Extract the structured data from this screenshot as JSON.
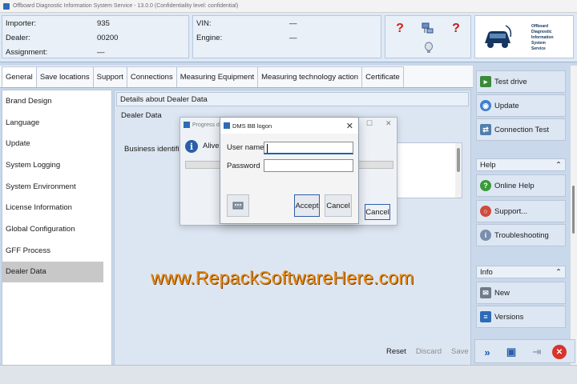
{
  "window": {
    "title": "Offboard Diagnostic Information System Service - 13.0.0 (Confidentiality level: confidential)"
  },
  "header": {
    "left": [
      {
        "label": "Importer:",
        "value": "935"
      },
      {
        "label": "Dealer:",
        "value": "00200"
      },
      {
        "label": "Assignment:",
        "value": "—"
      }
    ],
    "mid": [
      {
        "label": "VIN:",
        "value": "—"
      },
      {
        "label": "Engine:",
        "value": "—"
      }
    ],
    "logo_lines": [
      "Offboard",
      "Diagnostic",
      "Information",
      "System",
      "Service"
    ]
  },
  "tabs": [
    "General",
    "Save locations",
    "Support",
    "Connections",
    "Measuring Equipment",
    "Measuring technology action",
    "Certificate"
  ],
  "nav": [
    "Brand Design",
    "Language",
    "Update",
    "System Logging",
    "System Environment",
    "License Information",
    "Global Configuration",
    "GFF Process",
    "Dealer Data"
  ],
  "content": {
    "section_title": "Details about Dealer Data",
    "dealer_label": "Dealer Data",
    "business_label": "Business identifier"
  },
  "bottom_buttons": {
    "reset": "Reset",
    "discard": "Discard",
    "save": "Save"
  },
  "right_panel": {
    "top_buttons": [
      "Test drive",
      "Update",
      "Connection Test"
    ],
    "help_header": "Help",
    "help_items": [
      "Online Help",
      "Support...",
      "Troubleshooting"
    ],
    "info_header": "Info",
    "info_items": [
      "New",
      "Versions"
    ],
    "collapse_glyph": "»"
  },
  "progress_dialog": {
    "title": "Progress dia",
    "message": "Alive-T",
    "cancel": "Cancel"
  },
  "logon_dialog": {
    "title": "DMS BB logon",
    "username_label": "User name",
    "password_label": "Password",
    "username_value": "",
    "password_value": "",
    "accept": "Accept",
    "cancel": "Cancel"
  },
  "watermark": "www.RepackSoftwareHere.com",
  "colors": {
    "accent": "#2d5fa8",
    "watermark": "#e98a12",
    "panel": "#dde7f3"
  }
}
